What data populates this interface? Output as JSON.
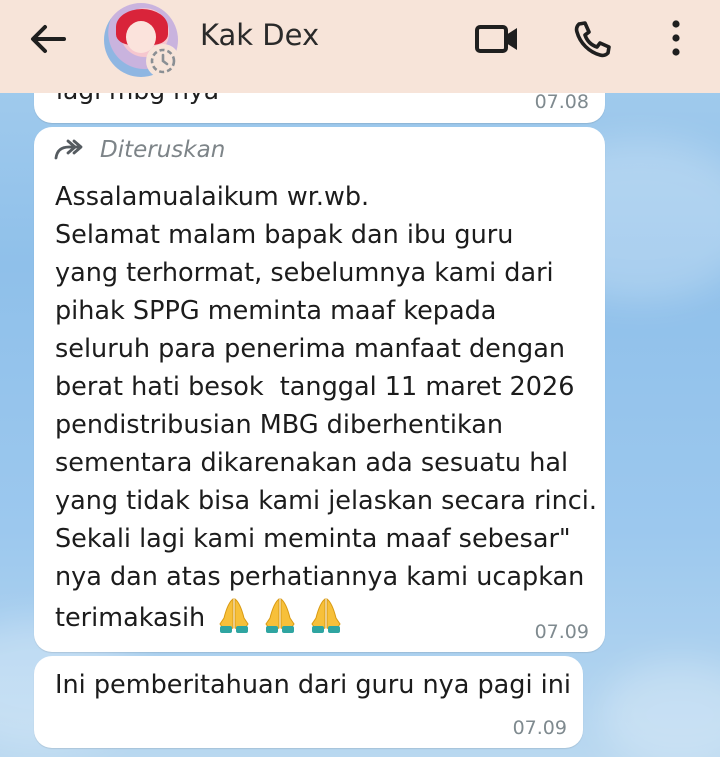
{
  "header": {
    "contact_name": "Kak Dex",
    "back_icon": "arrow-left-icon",
    "video_icon": "video-camera-icon",
    "call_icon": "phone-icon",
    "menu_icon": "more-vertical-icon",
    "status_icon": "status-ring-icon"
  },
  "messages": {
    "previous": {
      "partial_text": "lagi mbg nya",
      "time": "07.08"
    },
    "forwarded": {
      "forwarded_label": "Diteruskan",
      "lines": [
        "Assalamualaikum wr.wb.",
        "Selamat malam bapak dan ibu guru",
        "yang terhormat, sebelumnya kami dari",
        "pihak SPPG meminta maaf kepada",
        "seluruh para penerima manfaat dengan",
        "berat hati besok  tanggal 11 maret 2026",
        "pendistribusian MBG diberhentikan",
        "sementara dikarenakan ada sesuatu hal",
        "yang tidak bisa kami jelaskan secara rinci.",
        "Sekali lagi kami meminta maaf sebesar\"",
        "nya dan atas perhatiannya kami ucapkan",
        "terimakasih"
      ],
      "emoji": [
        "🙏",
        "🙏",
        "🙏"
      ],
      "time": "07.09"
    },
    "last": {
      "text": "Ini pemberitahuan dari guru nya pagi ini",
      "time": "07.09"
    }
  },
  "colors": {
    "header_bg": "#f7e4d9",
    "bubble_bg": "#ffffff",
    "chat_bg": "#9cc8ee",
    "timestamp": "#7f8a8f"
  }
}
